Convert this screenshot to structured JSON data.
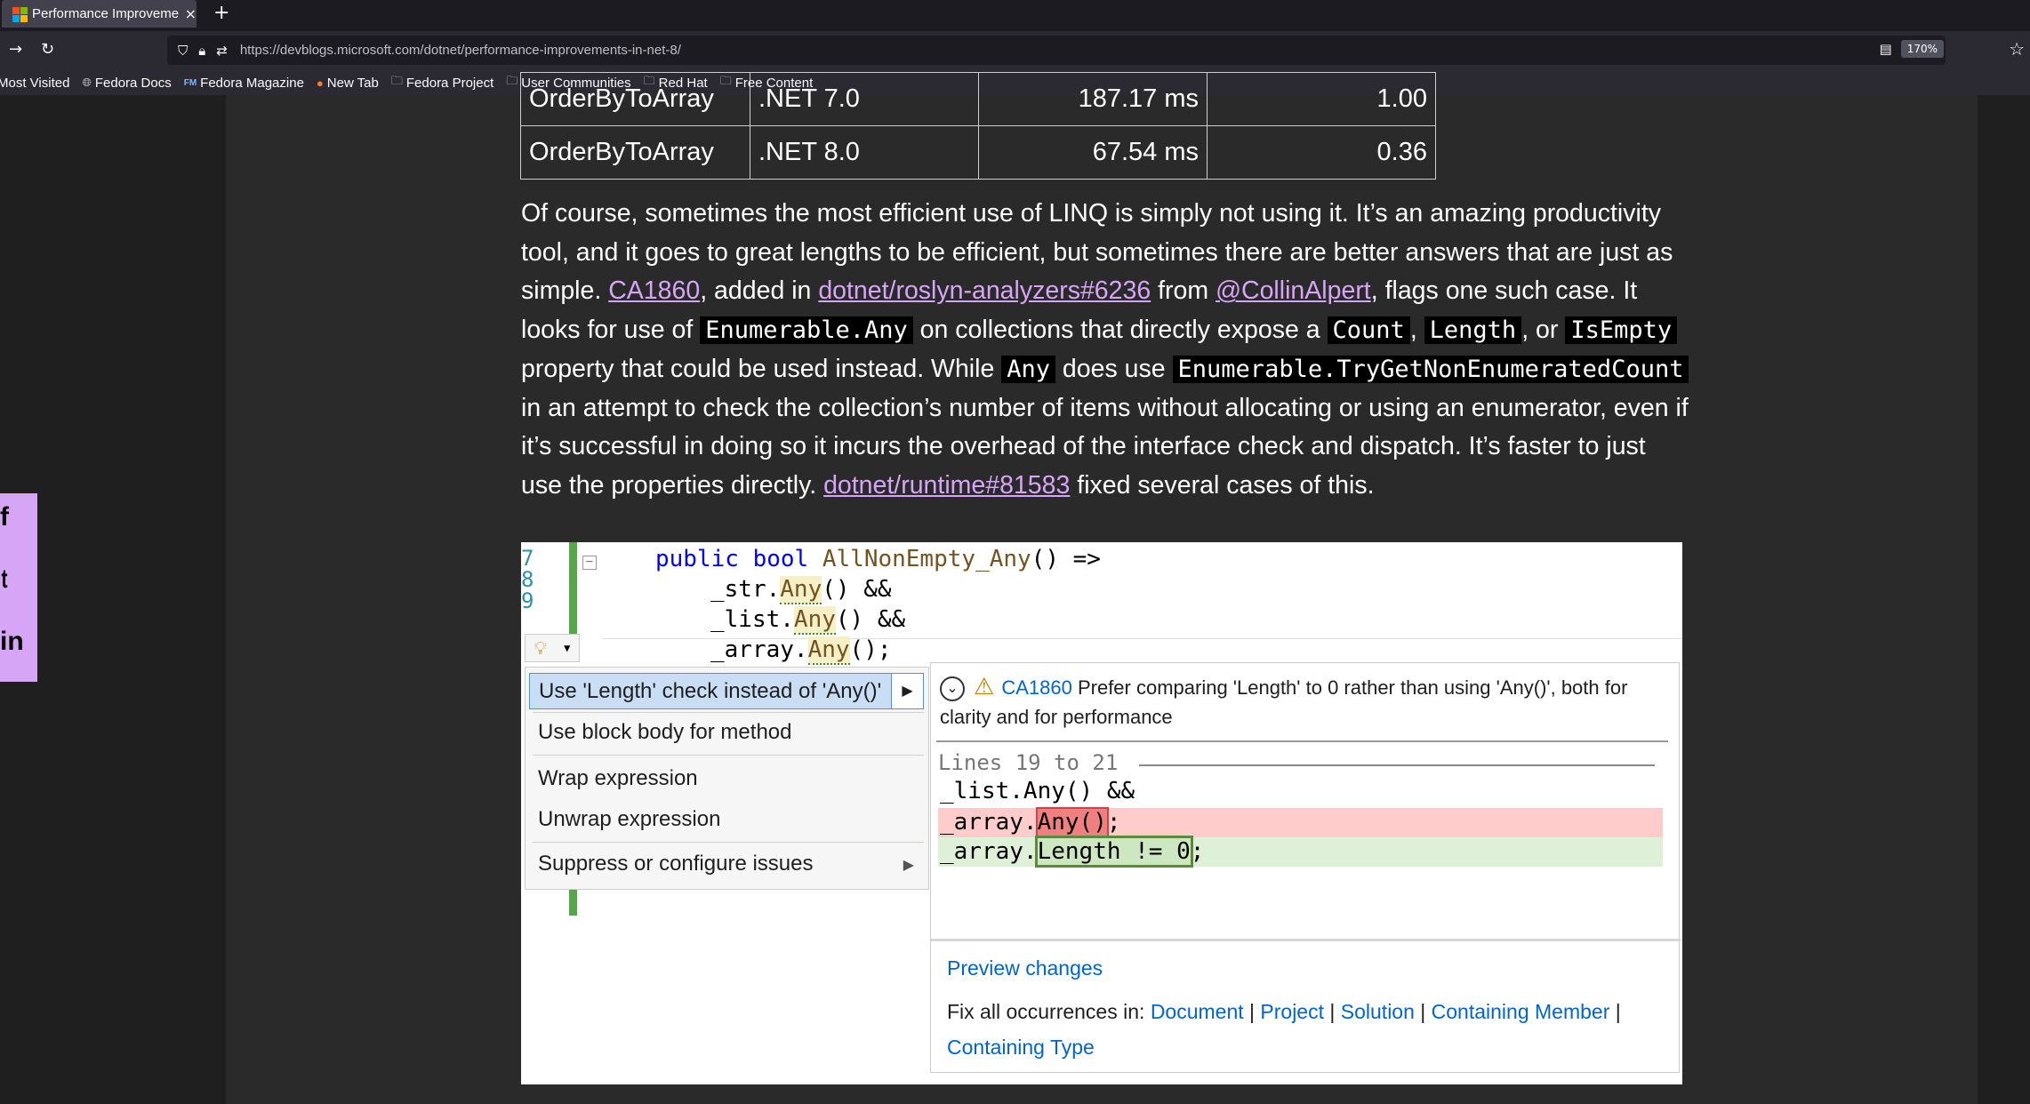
{
  "browser": {
    "tab_title": "Performance Improveme",
    "tab_close": "×",
    "new_tab": "+",
    "url": "https://devblogs.microsoft.com/dotnet/performance-improvements-in-net-8/",
    "zoom": "170%",
    "bookmarks": [
      {
        "label": "Most Visited",
        "icon": ""
      },
      {
        "label": "Fedora Docs",
        "icon": "globe-icon"
      },
      {
        "label": "Fedora Magazine",
        "icon": "fm-icon"
      },
      {
        "label": "New Tab",
        "icon": "firefox-icon"
      },
      {
        "label": "Fedora Project",
        "icon": "folder-icon"
      },
      {
        "label": "User Communities",
        "icon": "folder-icon"
      },
      {
        "label": "Red Hat",
        "icon": "folder-icon"
      },
      {
        "label": "Free Content",
        "icon": "folder-icon"
      }
    ]
  },
  "share": {
    "facebook": "f",
    "twitter": "t",
    "linkedin": "in"
  },
  "table": {
    "partial_row": [
      "OrderByToArray",
      ".NET 7.0",
      "187.17 ms",
      "1.00"
    ],
    "row": [
      "OrderByToArray",
      ".NET 8.0",
      "67.54 ms",
      "0.36"
    ]
  },
  "paragraph": {
    "t1": "Of course, sometimes the most efficient use of LINQ is simply not using it. It’s an amazing productivity tool, and it goes to great lengths to be efficient, but sometimes there are better answers that are just as simple. ",
    "link1": "CA1860",
    "t2": ", added in ",
    "link2": "dotnet/roslyn-analyzers#6236",
    "t3": " from ",
    "link3": "@CollinAlpert",
    "t4": ", flags one such case. It looks for use of ",
    "code1": "Enumerable.Any",
    "t5": " on collections that directly expose a ",
    "code2": "Count",
    "t6": ", ",
    "code3": "Length",
    "t7": ", or ",
    "code4": "IsEmpty",
    "t8": " property that could be used instead. While ",
    "code5": "Any",
    "t9": " does use ",
    "code6": "Enumerable.TryGetNonEnumeratedCount",
    "t10": " in an attempt to check the collection’s number of items without allocating or using an enumerator, even if it’s successful in doing so it incurs the overhead of the interface check and dispatch. It’s faster to just use the properties directly. ",
    "link4": "dotnet/runtime#81583",
    "t11": " fixed several cases of this."
  },
  "screenshot": {
    "line_numbers": [
      "7",
      "8",
      "9"
    ],
    "code": {
      "l1_kw1": "public",
      "l1_kw2": "bool",
      "l1_name": "AllNonEmpty_Any",
      "l1_rest": "() =>",
      "l2_a": "_str.",
      "l2_any": "Any",
      "l2_b": "() &&",
      "l3_a": "_list.",
      "l3_any": "Any",
      "l3_b": "() &&",
      "l4_a": "_array.",
      "l4_any": "Any",
      "l4_b": "();"
    },
    "menu": {
      "item1": "Use 'Length' check instead of 'Any()'",
      "item2": "Use block body for method",
      "item3": "Wrap expression",
      "item4": "Unwrap expression",
      "item5": "Suppress or configure issues"
    },
    "preview": {
      "rule_id": "CA1860",
      "message": "Prefer comparing 'Length' to 0 rather than using 'Any()', both for clarity and for performance",
      "lines_label": "Lines 19 to 21",
      "code1": "_list.Any() &&",
      "code2_a": "_array.",
      "code2_b": "Any()",
      "code2_c": ";",
      "code3_a": "_array.",
      "code3_b": "Length != 0",
      "code3_c": ";",
      "preview_changes": "Preview changes",
      "fix_all_label": "Fix all occurrences in:",
      "scope_document": "Document",
      "scope_project": "Project",
      "scope_solution": "Solution",
      "scope_member": "Containing Member",
      "scope_type": "Containing Type",
      "separator": "|"
    }
  }
}
